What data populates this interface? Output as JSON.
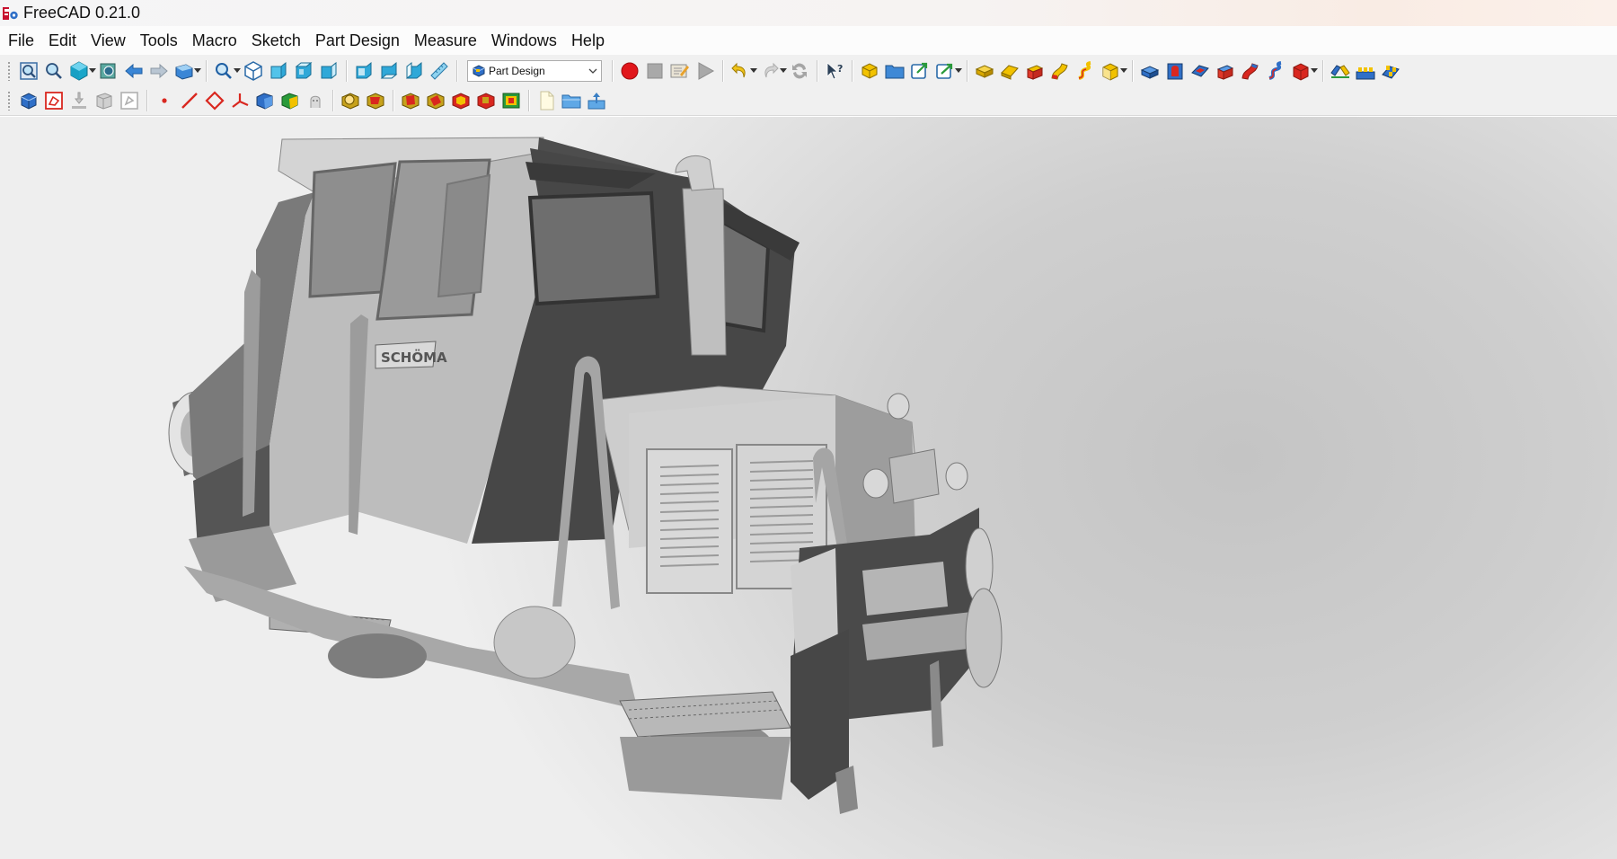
{
  "window": {
    "title": "FreeCAD 0.21.0"
  },
  "menubar": {
    "items": [
      {
        "label": "File"
      },
      {
        "label": "Edit"
      },
      {
        "label": "View"
      },
      {
        "label": "Tools"
      },
      {
        "label": "Macro"
      },
      {
        "label": "Sketch"
      },
      {
        "label": "Part Design"
      },
      {
        "label": "Measure"
      },
      {
        "label": "Windows"
      },
      {
        "label": "Help"
      }
    ]
  },
  "toolbar": {
    "workbench_selector": {
      "value": "Part Design"
    }
  },
  "viewport": {
    "model_label": "SCHÖMA"
  },
  "colors": {
    "record_button": "#e1161b",
    "part_design_blue": "#2f6fc7",
    "part_design_yellow": "#f2c200",
    "part_design_red": "#d9271f",
    "model_light": "#c9c9c9",
    "model_dark": "#4a4a4a"
  },
  "icons": {
    "row1": [
      "fit-all-icon",
      "fit-selection-icon",
      "standard-views-icon",
      "bounding-box-icon",
      "back-icon",
      "forward-icon",
      "sync-view-icon",
      "zoom-icon",
      "isometric-view-icon",
      "front-view-icon",
      "top-view-icon",
      "right-view-icon",
      "rear-view-icon",
      "bottom-view-icon",
      "left-view-icon",
      "measure-distance-icon",
      "record-macro-icon",
      "stop-macro-icon",
      "edit-macro-icon",
      "run-macro-icon",
      "undo-icon",
      "redo-icon",
      "refresh-icon",
      "whats-this-icon",
      "part-icon",
      "group-icon",
      "link-icon",
      "link-actions-icon",
      "pad-icon",
      "revolution-icon",
      "additive-loft-icon",
      "additive-pipe-icon",
      "additive-helix-icon",
      "additive-primitive-icon",
      "pocket-icon",
      "hole-icon",
      "groove-icon",
      "subtractive-loft-icon",
      "subtractive-pipe-icon",
      "subtractive-helix-icon",
      "subtractive-primitive-icon",
      "mirrored-icon",
      "linear-pattern-icon",
      "polar-pattern-icon"
    ],
    "row2": [
      "create-body-icon",
      "create-sketch-icon",
      "validate-sketch-icon",
      "shape-binder-icon",
      "clone-icon",
      "datum-point-icon",
      "datum-line-icon",
      "datum-plane-icon",
      "local-coordinate-system-icon",
      "sub-shape-binder-icon",
      "fillet-icon",
      "chamfer-icon",
      "draft-icon",
      "thickness-icon",
      "boolean-icon",
      "new-document-icon",
      "open-document-icon",
      "save-document-icon"
    ]
  }
}
